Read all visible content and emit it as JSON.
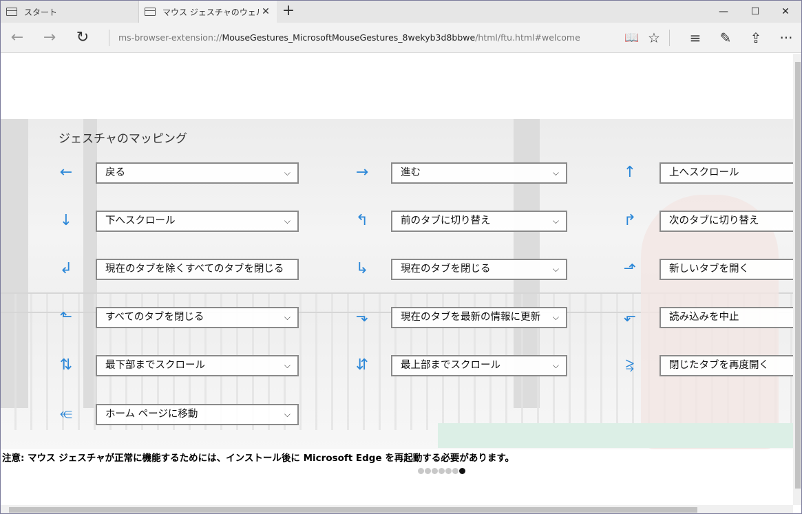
{
  "tabs": [
    {
      "label": "スタート",
      "icon": "start-page-icon"
    },
    {
      "label": "マウス ジェスチャのウェルカム",
      "icon": "page-icon",
      "close": "✕"
    }
  ],
  "window_controls": {
    "minimize": "—",
    "maximize": "☐",
    "close": "✕"
  },
  "navigation": {
    "back": "←",
    "forward": "→",
    "refresh": "↻"
  },
  "address": {
    "scheme": "ms-browser-extension://",
    "host": "MouseGestures_MicrosoftMouseGestures_8wekyb3d8bbwe",
    "path": "/html/ftu.html#welcome"
  },
  "toolbar": {
    "reading_view": "📖",
    "favorite": "☆",
    "hub": "≡",
    "web_note": "✎",
    "share": "⇪",
    "more": "···"
  },
  "page": {
    "heading": "ジェスチャのマッピング",
    "gestures": [
      {
        "arrow": "←",
        "action": "戻る"
      },
      {
        "arrow": "→",
        "action": "進む"
      },
      {
        "arrow": "↑",
        "action": "上へスクロール"
      },
      {
        "arrow": "↓",
        "action": "下へスクロール"
      },
      {
        "arrow": "↰",
        "action": "前のタブに切り替え"
      },
      {
        "arrow": "↱",
        "action": "次のタブに切り替え"
      },
      {
        "arrow": "↲",
        "action": "現在のタブを除くすべてのタブを閉じる"
      },
      {
        "arrow": "↳",
        "action": "現在のタブを閉じる"
      },
      {
        "arrow": "⬏",
        "action": "新しいタブを開く"
      },
      {
        "arrow": "⬑",
        "action": "すべてのタブを閉じる"
      },
      {
        "arrow": "⬎",
        "action": "現在のタブを最新の情報に更新"
      },
      {
        "arrow": "⬐",
        "action": "読み込みを中止"
      },
      {
        "arrow": "⇅",
        "action": "最下部までスクロール"
      },
      {
        "arrow": "⇵",
        "action": "最上部までスクロール"
      },
      {
        "arrow": "⥸",
        "action": "閉じたタブを再度開く"
      },
      {
        "arrow": "⥺",
        "action": "ホーム ページに移動"
      }
    ],
    "chevron": "⌵",
    "notice": "注意: マウス ジェスチャが正常に機能するためには、インストール後に Microsoft Edge を再起動する必要があります。",
    "pager": {
      "total": 7,
      "current": 7
    }
  },
  "colors": {
    "arrow": "#2b87d8",
    "tabstrip": "#e6e6e6",
    "toolbar": "#f2f2f2"
  }
}
